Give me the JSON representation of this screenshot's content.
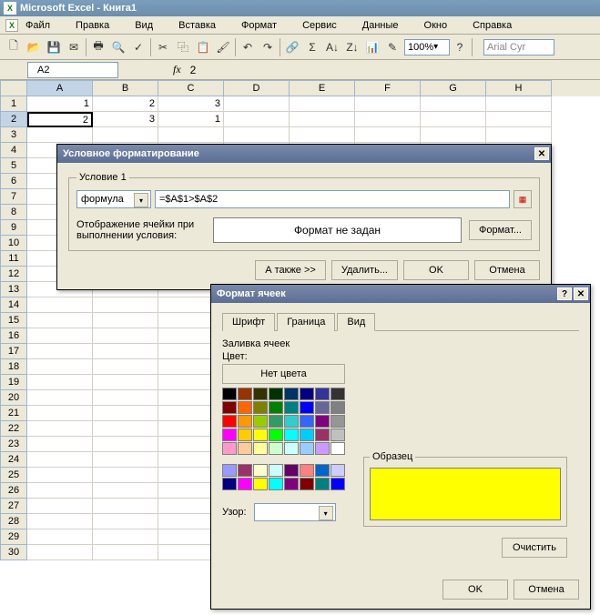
{
  "title": "Microsoft Excel - Книга1",
  "menu": [
    "Файл",
    "Правка",
    "Вид",
    "Вставка",
    "Формат",
    "Сервис",
    "Данные",
    "Окно",
    "Справка"
  ],
  "zoom": "100%",
  "font_name": "Arial Cyr",
  "namebox": "A2",
  "formula": "2",
  "columns": [
    "A",
    "B",
    "C",
    "D",
    "E",
    "F",
    "G",
    "H"
  ],
  "rows": [
    "1",
    "2",
    "3",
    "4",
    "5",
    "6",
    "7",
    "8",
    "9",
    "10",
    "11",
    "12",
    "13",
    "14",
    "15",
    "16",
    "17",
    "18",
    "19",
    "20",
    "21",
    "22",
    "23",
    "24",
    "25",
    "26",
    "27",
    "28",
    "29",
    "30"
  ],
  "cells": {
    "r1": [
      "1",
      "2",
      "3"
    ],
    "r2": [
      "2",
      "3",
      "1"
    ]
  },
  "dlg1": {
    "title": "Условное форматирование",
    "legend": "Условие 1",
    "combo": "формула",
    "expr": "=$A$1>$A$2",
    "display_label": "Отображение ячейки при выполнении условия:",
    "preview": "Формат не задан",
    "format_btn": "Формат...",
    "also": "А также >>",
    "delete": "Удалить...",
    "ok": "OK",
    "cancel": "Отмена"
  },
  "dlg2": {
    "title": "Формат ячеек",
    "tabs": [
      "Шрифт",
      "Граница",
      "Вид"
    ],
    "fill_label": "Заливка ячеек",
    "color_label": "Цвет:",
    "no_color": "Нет цвета",
    "pattern_label": "Узор:",
    "sample_label": "Образец",
    "clear": "Очистить",
    "ok": "OK",
    "cancel": "Отмена",
    "palette1": [
      "#000000",
      "#993300",
      "#333300",
      "#003300",
      "#003366",
      "#000080",
      "#333399",
      "#333333",
      "#800000",
      "#ff6600",
      "#808000",
      "#008000",
      "#008080",
      "#0000ff",
      "#666699",
      "#808080",
      "#ff0000",
      "#ff9900",
      "#99cc00",
      "#339966",
      "#33cccc",
      "#3366ff",
      "#800080",
      "#969696",
      "#ff00ff",
      "#ffcc00",
      "#ffff00",
      "#00ff00",
      "#00ffff",
      "#00ccff",
      "#993366",
      "#c0c0c0",
      "#ff99cc",
      "#ffcc99",
      "#ffff99",
      "#ccffcc",
      "#ccffff",
      "#99ccff",
      "#cc99ff",
      "#ffffff"
    ],
    "palette2": [
      "#9999ff",
      "#993366",
      "#ffffcc",
      "#ccffff",
      "#660066",
      "#ff8080",
      "#0066cc",
      "#ccccff",
      "#000080",
      "#ff00ff",
      "#ffff00",
      "#00ffff",
      "#800080",
      "#800000",
      "#008080",
      "#0000ff"
    ]
  }
}
